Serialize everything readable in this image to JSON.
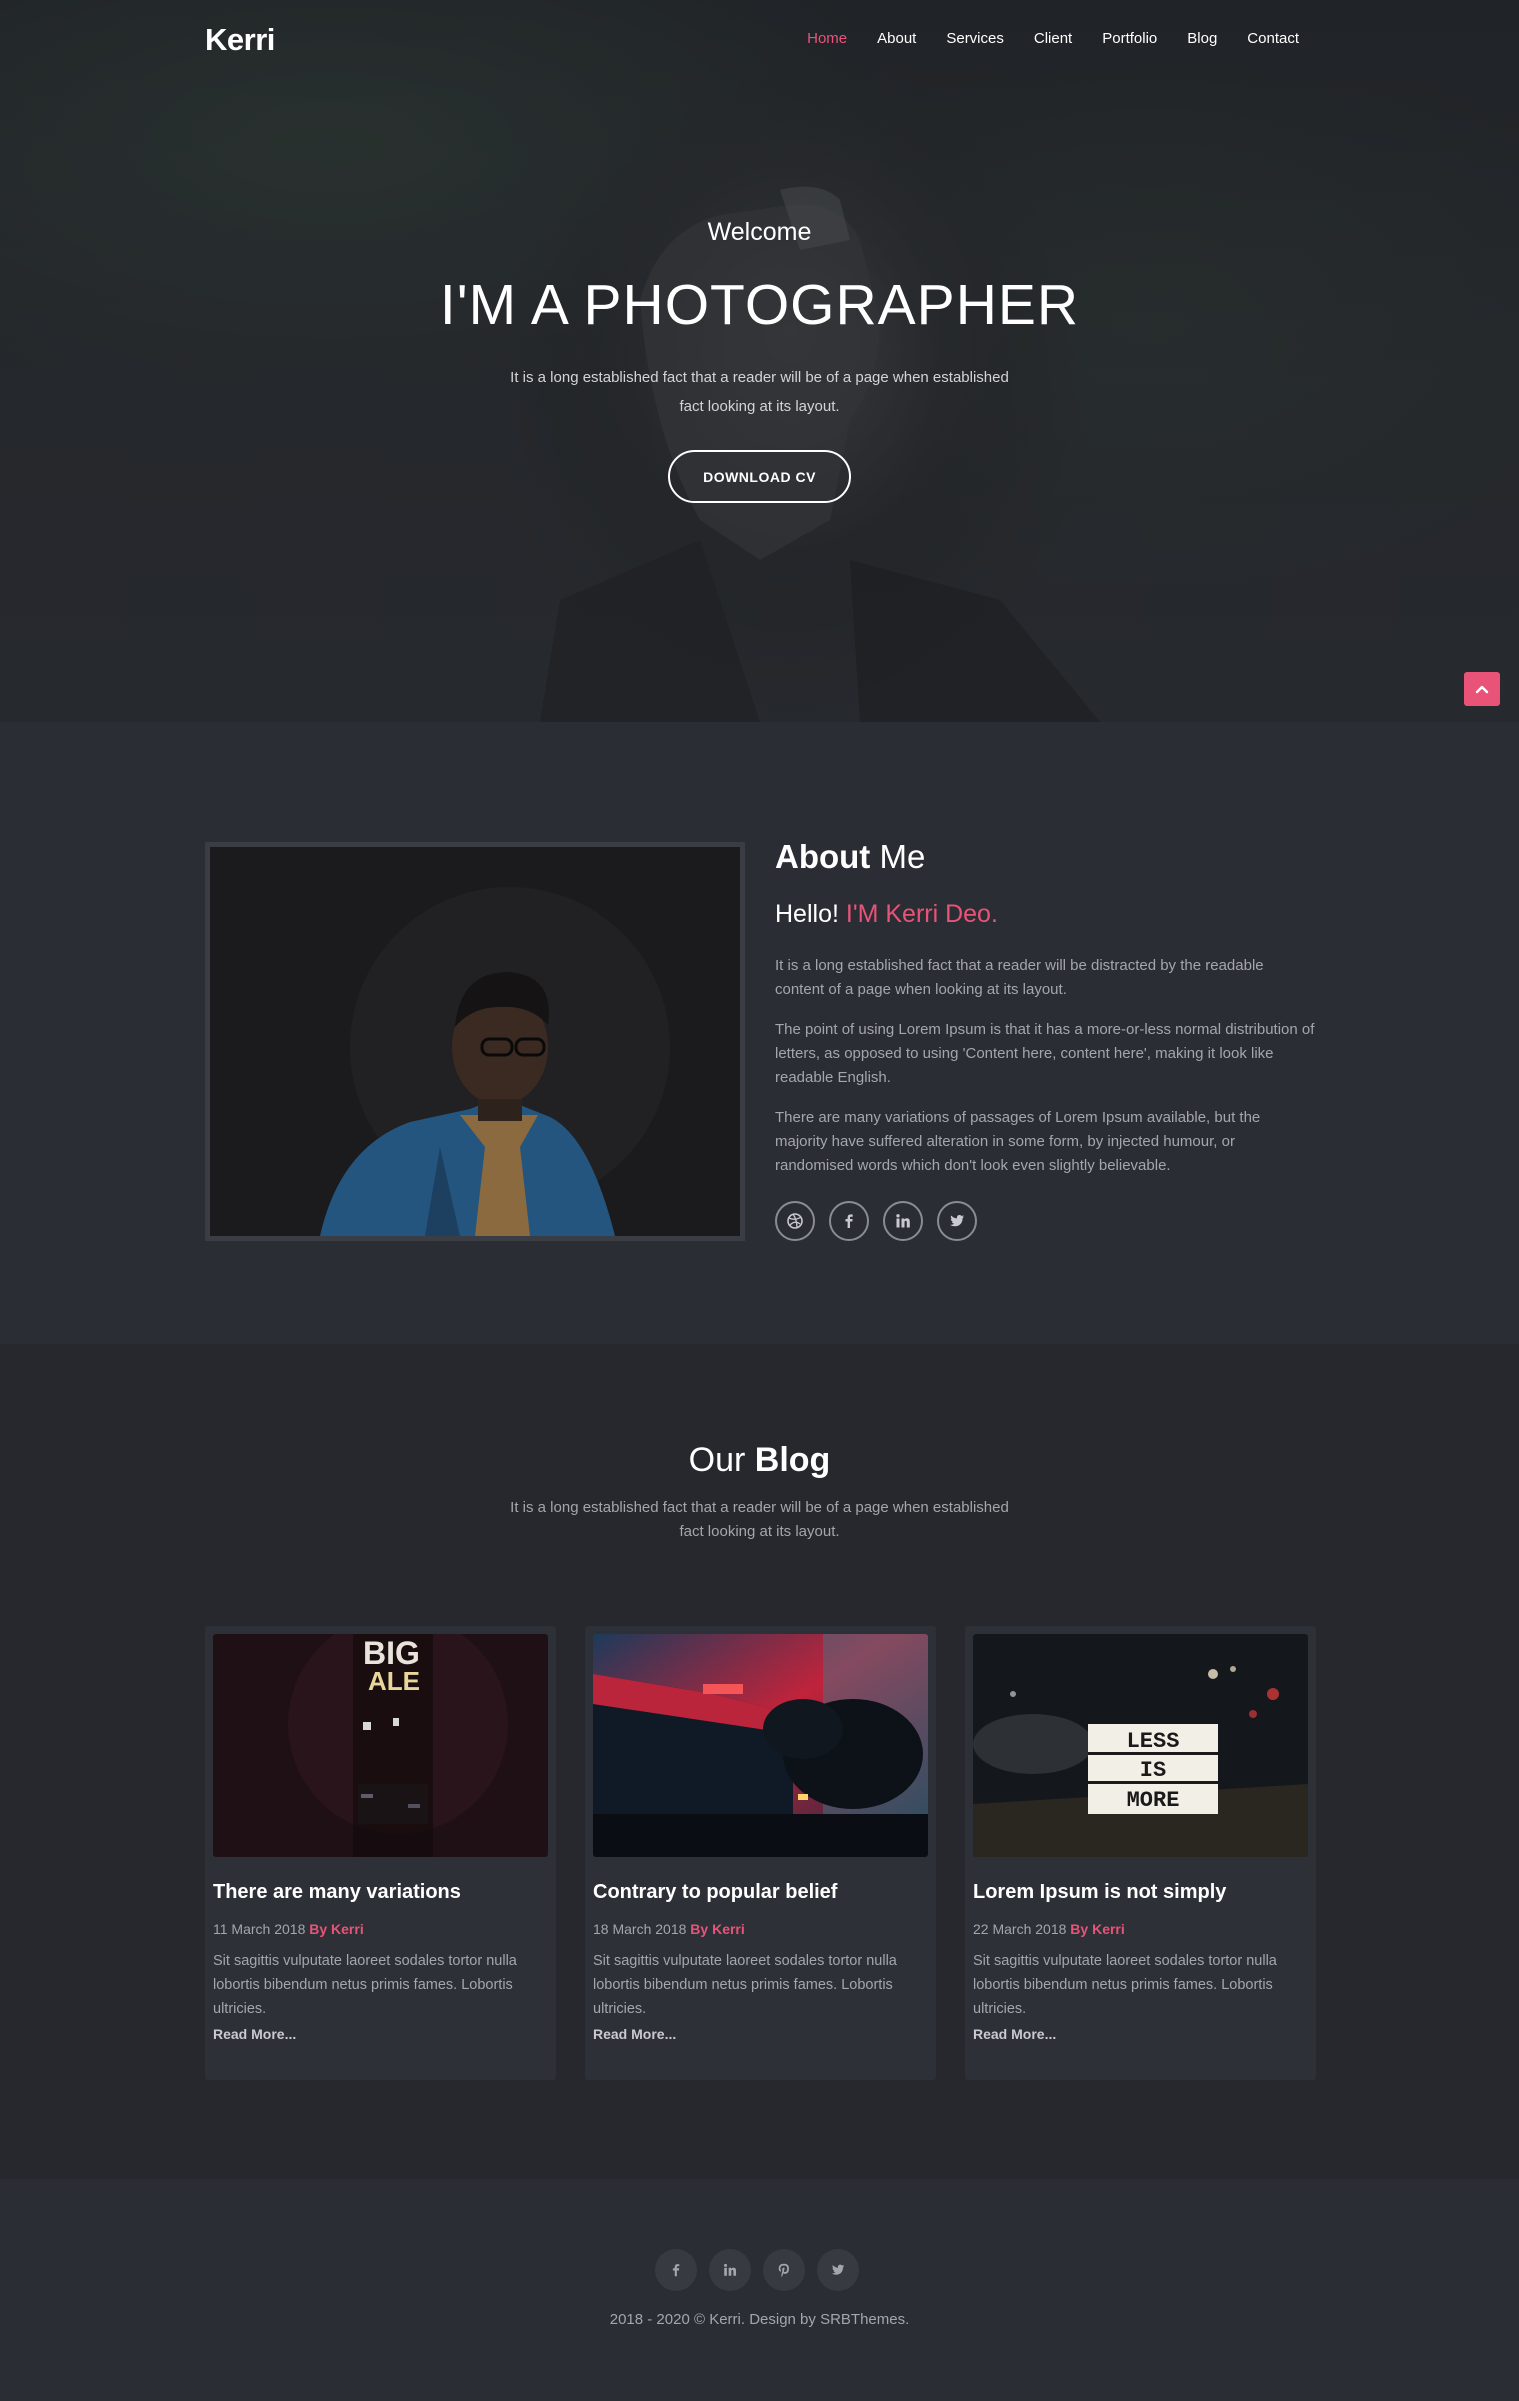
{
  "brand": "Kerri",
  "nav": {
    "items": [
      {
        "label": "Home",
        "active": true
      },
      {
        "label": "About",
        "active": false
      },
      {
        "label": "Services",
        "active": false
      },
      {
        "label": "Client",
        "active": false
      },
      {
        "label": "Portfolio",
        "active": false
      },
      {
        "label": "Blog",
        "active": false
      },
      {
        "label": "Contact",
        "active": false
      }
    ]
  },
  "hero": {
    "welcome": "Welcome",
    "title": "I'M A PHOTOGRAPHER",
    "text": "It is a long established fact that a reader will be of a page when established fact looking at its layout.",
    "button": "DOWNLOAD CV"
  },
  "about": {
    "heading_bold": "About",
    "heading_rest": " Me",
    "hello": "Hello!",
    "name": "I'M Kerri Deo.",
    "paragraphs": [
      "It is a long established fact that a reader will be distracted by the readable content of a page when looking at its layout.",
      "The point of using Lorem Ipsum is that it has a more-or-less normal distribution of letters, as opposed to using 'Content here, content here', making it look like readable English.",
      "There are many variations of passages of Lorem Ipsum available, but the majority have suffered alteration in some form, by injected humour, or randomised words which don't look even slightly believable."
    ],
    "socials": [
      "dribbble-icon",
      "facebook-icon",
      "linkedin-icon",
      "twitter-icon"
    ]
  },
  "blog": {
    "heading_rest": "Our ",
    "heading_bold": "Blog",
    "subtitle": "It is a long established fact that a reader will be of a page when established fact looking at its layout.",
    "posts": [
      {
        "title": "There are many variations",
        "date": "11 March 2018",
        "by": "By Kerri",
        "excerpt": "Sit sagittis vulputate laoreet sodales tortor nulla lobortis bibendum netus primis fames. Lobortis ultricies.",
        "more": "Read More..."
      },
      {
        "title": "Contrary to popular belief",
        "date": "18 March 2018",
        "by": "By Kerri",
        "excerpt": "Sit sagittis vulputate laoreet sodales tortor nulla lobortis bibendum netus primis fames. Lobortis ultricies.",
        "more": "Read More..."
      },
      {
        "title": "Lorem Ipsum is not simply",
        "date": "22 March 2018",
        "by": "By Kerri",
        "excerpt": "Sit sagittis vulputate laoreet sodales tortor nulla lobortis bibendum netus primis fames. Lobortis ultricies.",
        "more": "Read More..."
      }
    ],
    "image_text": {
      "post1": "BIG ALE",
      "post3_lines": [
        "LESS",
        "IS",
        "MORE"
      ]
    }
  },
  "footer": {
    "socials": [
      "facebook-icon",
      "linkedin-icon",
      "pinterest-icon",
      "twitter-icon"
    ],
    "copyright": "2018 - 2020 © Kerri. Design by SRBThemes."
  },
  "colors": {
    "accent": "#e95378",
    "background": "#2b2d34",
    "blog_background": "#26282e",
    "card": "#2e3037",
    "muted_text": "#a4a6ad"
  }
}
